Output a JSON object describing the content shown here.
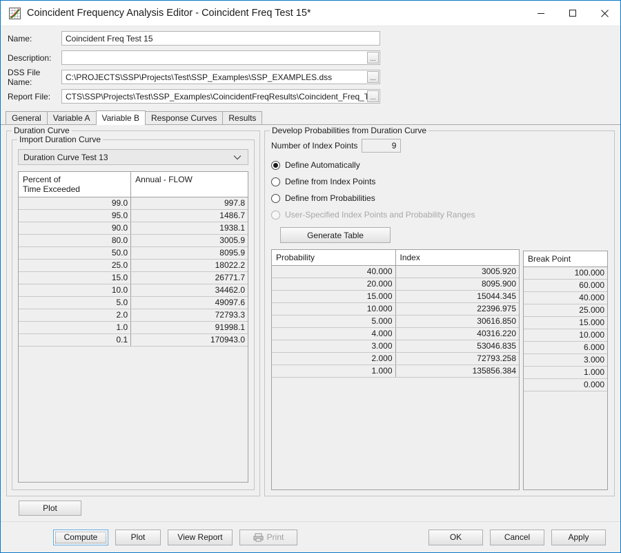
{
  "window": {
    "title": "Coincident Frequency Analysis Editor - Coincident Freq Test 15*",
    "icon": "chart-curve-icon",
    "minimize_label": "–",
    "maximize_label": "□",
    "close_label": "✕"
  },
  "form": {
    "name_label": "Name:",
    "name_value": "Coincident Freq Test 15",
    "description_label": "Description:",
    "description_value": "",
    "dss_label": "DSS File Name:",
    "dss_value": "C:\\PROJECTS\\SSP\\Projects\\Test\\SSP_Examples\\SSP_EXAMPLES.dss",
    "report_label": "Report File:",
    "report_value": "CTS\\SSP\\Projects\\Test\\SSP_Examples\\CoincidentFreqResults\\Coincident_Freq_Te",
    "browse_label": "..."
  },
  "tabs": [
    {
      "label": "General",
      "active": false
    },
    {
      "label": "Variable A",
      "active": false
    },
    {
      "label": "Variable B",
      "active": true
    },
    {
      "label": "Response Curves",
      "active": false
    },
    {
      "label": "Results",
      "active": false
    }
  ],
  "duration_curve": {
    "group_title": "Duration Curve",
    "import_title": "Import Duration Curve",
    "combo_value": "Duration Curve Test 13",
    "table": {
      "headers": [
        "Percent of\nTime Exceeded",
        "Annual - FLOW"
      ],
      "header_line1": "Percent of",
      "header_line2": "Time Exceeded",
      "header_col2": "Annual - FLOW",
      "rows": [
        [
          "99.0",
          "997.8"
        ],
        [
          "95.0",
          "1486.7"
        ],
        [
          "90.0",
          "1938.1"
        ],
        [
          "80.0",
          "3005.9"
        ],
        [
          "50.0",
          "8095.9"
        ],
        [
          "25.0",
          "18022.2"
        ],
        [
          "15.0",
          "26771.7"
        ],
        [
          "10.0",
          "34462.0"
        ],
        [
          "5.0",
          "49097.6"
        ],
        [
          "2.0",
          "72793.3"
        ],
        [
          "1.0",
          "91998.1"
        ],
        [
          "0.1",
          "170943.0"
        ]
      ]
    },
    "plot_button": "Plot"
  },
  "develop": {
    "group_title": "Develop Probabilities from Duration Curve",
    "index_points_label": "Number of Index Points",
    "index_points_value": "9",
    "options": [
      {
        "label": "Define Automatically",
        "selected": true,
        "disabled": false
      },
      {
        "label": "Define from Index Points",
        "selected": false,
        "disabled": false
      },
      {
        "label": "Define from Probabilities",
        "selected": false,
        "disabled": false
      },
      {
        "label": "User-Specified Index Points and Probability Ranges",
        "selected": false,
        "disabled": true
      }
    ],
    "generate_table_label": "Generate Table",
    "prob_table": {
      "headers": [
        "Probability",
        "Index"
      ],
      "rows": [
        [
          "40.000",
          "3005.920"
        ],
        [
          "20.000",
          "8095.900"
        ],
        [
          "15.000",
          "15044.345"
        ],
        [
          "10.000",
          "22396.975"
        ],
        [
          "5.000",
          "30616.850"
        ],
        [
          "4.000",
          "40316.220"
        ],
        [
          "3.000",
          "53046.835"
        ],
        [
          "2.000",
          "72793.258"
        ],
        [
          "1.000",
          "135856.384"
        ]
      ]
    },
    "break_table": {
      "header": "Break Point",
      "rows": [
        "100.000",
        "60.000",
        "40.000",
        "25.000",
        "15.000",
        "10.000",
        "6.000",
        "3.000",
        "1.000",
        "0.000"
      ]
    }
  },
  "footer": {
    "compute": "Compute",
    "plot": "Plot",
    "view_report": "View Report",
    "print": "Print",
    "ok": "OK",
    "cancel": "Cancel",
    "apply": "Apply"
  },
  "colors": {
    "accent": "#0a76c8",
    "window_bg": "#f0f0f0",
    "table_row": "#efefef",
    "border": "#a0a0a0"
  }
}
